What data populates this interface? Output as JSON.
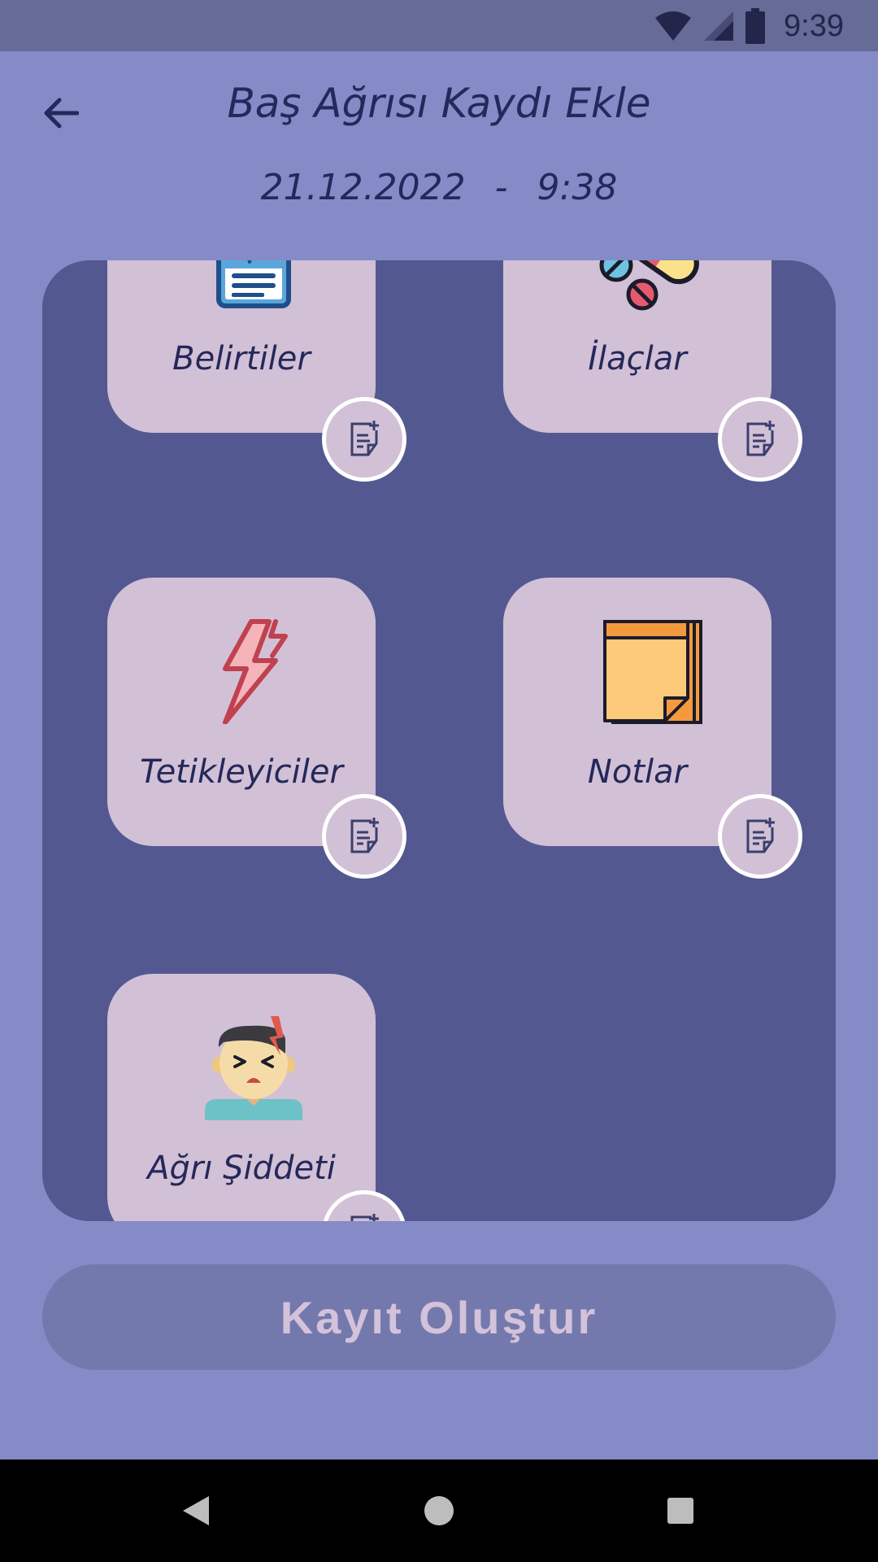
{
  "status_bar": {
    "time": "9:39",
    "icons": [
      "wifi-icon",
      "signal-icon",
      "battery-icon"
    ]
  },
  "header": {
    "title": "Baş Ağrısı Kaydı Ekle",
    "date": "21.12.2022",
    "separator": "-",
    "time": "9:38"
  },
  "categories": [
    {
      "label": "Belirtiler",
      "icon": "symptoms-clipboard-icon"
    },
    {
      "label": "İlaçlar",
      "icon": "pills-icon"
    },
    {
      "label": "Tetikleyiciler",
      "icon": "lightning-icon"
    },
    {
      "label": "Notlar",
      "icon": "sticky-note-icon"
    },
    {
      "label": "Ağrı Şiddeti",
      "icon": "headache-person-icon"
    }
  ],
  "actions": {
    "create_label": "Kayıt Oluştur"
  },
  "colors": {
    "background": "#848bc6",
    "panel": "#535990",
    "card": "#d2c0d6",
    "text": "#24285a",
    "button": "#7479ad"
  }
}
